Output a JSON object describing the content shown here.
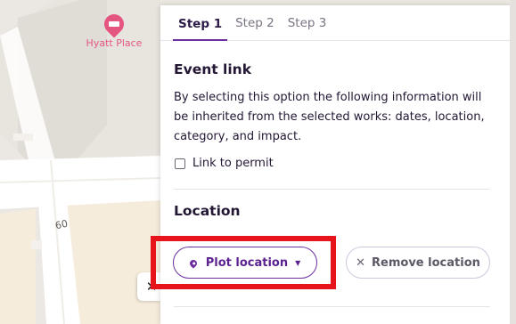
{
  "map": {
    "poi_label": "Hyatt Place",
    "poi_icon": "hotel-icon",
    "street_number": "60",
    "collapse_icon": "close-icon",
    "collapse_glyph": "✕"
  },
  "tabs": [
    {
      "label": "Step 1",
      "active": true
    },
    {
      "label": "Step 2",
      "active": false
    },
    {
      "label": "Step 3",
      "active": false
    }
  ],
  "event_link": {
    "title": "Event link",
    "description": "By selecting this option the following information will be inherited from the selected works: dates, location, category, and impact.",
    "checkbox_label": "Link to permit",
    "checked": false
  },
  "location": {
    "title": "Location",
    "plot_button": "Plot location",
    "plot_icon": "map-pin-icon",
    "caret": "▼",
    "remove_button": "Remove location",
    "remove_icon": "close-icon",
    "remove_glyph": "✕"
  },
  "colors": {
    "accent": "#6b2fa0",
    "poi": "#e4567f",
    "highlight": "#e8141c"
  }
}
